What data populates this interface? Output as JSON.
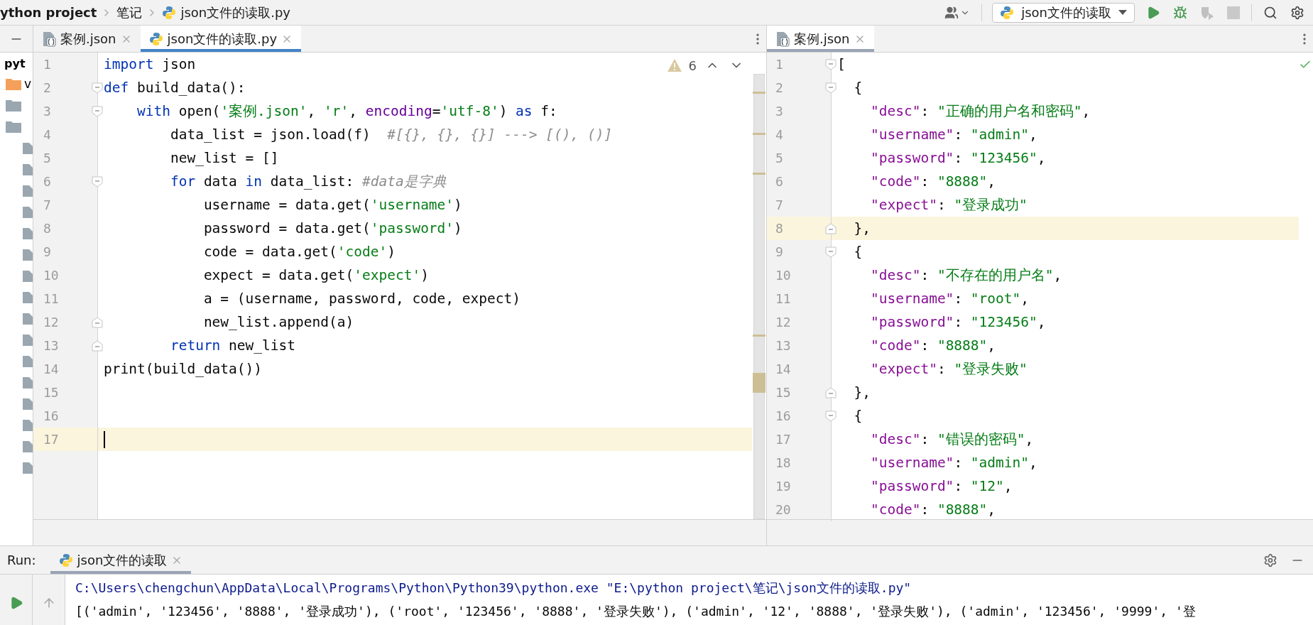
{
  "nav_bar": {
    "breadcrumbs": [
      {
        "label": "ython project",
        "kind": "project"
      },
      {
        "label": "笔记",
        "kind": "folder"
      },
      {
        "label": "json文件的读取.py",
        "kind": "python"
      }
    ],
    "run_config": "json文件的读取"
  },
  "project_tree": {
    "title": "pyt",
    "items": [
      {
        "label": "v",
        "kind": "venv"
      }
    ]
  },
  "editors": [
    {
      "focused": true,
      "inspections": {
        "kind": "warning",
        "count": "6"
      },
      "tabs": [
        {
          "label": "案例.json",
          "kind": "json",
          "selected": false
        },
        {
          "label": "json文件的读取.py",
          "kind": "python",
          "selected": true
        }
      ],
      "lines": [
        {
          "number": "1",
          "kind": "code",
          "current": false,
          "tokens": [
            {
              "kind": "keyword",
              "text": "import"
            },
            {
              "kind": "plain",
              "text": " json"
            }
          ]
        },
        {
          "number": "2",
          "kind": "fold-start",
          "current": false,
          "tokens": [
            {
              "kind": "keyword",
              "text": "def"
            },
            {
              "kind": "plain",
              "text": " build_data():"
            }
          ]
        },
        {
          "number": "3",
          "kind": "fold-start",
          "current": false,
          "tokens": [
            {
              "kind": "keyword",
              "text": "    with"
            },
            {
              "kind": "plain",
              "text": " open("
            },
            {
              "kind": "string",
              "text": "'案例.json'"
            },
            {
              "kind": "plain",
              "text": ", "
            },
            {
              "kind": "string",
              "text": "'r'"
            },
            {
              "kind": "plain",
              "text": ", "
            },
            {
              "kind": "param",
              "text": "encoding"
            },
            {
              "kind": "plain",
              "text": "="
            },
            {
              "kind": "string",
              "text": "'utf-8'"
            },
            {
              "kind": "plain",
              "text": ") "
            },
            {
              "kind": "keyword",
              "text": "as"
            },
            {
              "kind": "plain",
              "text": " f:"
            }
          ]
        },
        {
          "number": "4",
          "kind": "code",
          "current": false,
          "tokens": [
            {
              "kind": "plain",
              "text": "        data_list = json.load(f)  "
            },
            {
              "kind": "comment",
              "text": "#[{}, {}, {}] ---> [(), ()]"
            }
          ]
        },
        {
          "number": "5",
          "kind": "code",
          "current": false,
          "tokens": [
            {
              "kind": "plain",
              "text": "        new_list = []"
            }
          ]
        },
        {
          "number": "6",
          "kind": "fold-start",
          "current": false,
          "tokens": [
            {
              "kind": "keyword",
              "text": "        for"
            },
            {
              "kind": "plain",
              "text": " data "
            },
            {
              "kind": "keyword",
              "text": "in"
            },
            {
              "kind": "plain",
              "text": " data_list: "
            },
            {
              "kind": "comment",
              "text": "#data是字典"
            }
          ]
        },
        {
          "number": "7",
          "kind": "code",
          "current": false,
          "tokens": [
            {
              "kind": "plain",
              "text": "            username = data.get("
            },
            {
              "kind": "string",
              "text": "'username'"
            },
            {
              "kind": "plain",
              "text": ")"
            }
          ]
        },
        {
          "number": "8",
          "kind": "code",
          "current": false,
          "tokens": [
            {
              "kind": "plain",
              "text": "            password = data.get("
            },
            {
              "kind": "string",
              "text": "'password'"
            },
            {
              "kind": "plain",
              "text": ")"
            }
          ]
        },
        {
          "number": "9",
          "kind": "code",
          "current": false,
          "tokens": [
            {
              "kind": "plain",
              "text": "            code = data.get("
            },
            {
              "kind": "string",
              "text": "'code'"
            },
            {
              "kind": "plain",
              "text": ")"
            }
          ]
        },
        {
          "number": "10",
          "kind": "code",
          "current": false,
          "tokens": [
            {
              "kind": "plain",
              "text": "            expect = data.get("
            },
            {
              "kind": "string",
              "text": "'expect'"
            },
            {
              "kind": "plain",
              "text": ")"
            }
          ]
        },
        {
          "number": "11",
          "kind": "code",
          "current": false,
          "tokens": [
            {
              "kind": "plain",
              "text": "            a = (username, password, code, expect)"
            }
          ]
        },
        {
          "number": "12",
          "kind": "fold-end",
          "current": false,
          "tokens": [
            {
              "kind": "plain",
              "text": "            new_list.append(a)"
            }
          ]
        },
        {
          "number": "13",
          "kind": "fold-end",
          "current": false,
          "tokens": [
            {
              "kind": "keyword",
              "text": "        return"
            },
            {
              "kind": "plain",
              "text": " new_list"
            }
          ]
        },
        {
          "number": "14",
          "kind": "code",
          "current": false,
          "tokens": [
            {
              "kind": "plain",
              "text": "print(build_data())"
            }
          ]
        },
        {
          "number": "15",
          "kind": "code",
          "current": false
        },
        {
          "number": "16",
          "kind": "code",
          "current": false
        },
        {
          "number": "17",
          "kind": "code",
          "current": true
        }
      ]
    },
    {
      "focused": false,
      "inspections": {
        "kind": "ok"
      },
      "tabs": [
        {
          "label": "案例.json",
          "kind": "json",
          "selected": true
        }
      ],
      "lines": [
        {
          "number": "1",
          "kind": "fold-start",
          "current": false,
          "tokens": [
            {
              "kind": "plain",
              "text": "["
            }
          ]
        },
        {
          "number": "2",
          "kind": "fold-start",
          "current": false,
          "tokens": [
            {
              "kind": "plain",
              "text": "  {"
            }
          ]
        },
        {
          "number": "3",
          "kind": "code",
          "current": false,
          "tokens": [
            {
              "kind": "key",
              "text": "    \"desc\""
            },
            {
              "kind": "plain",
              "text": ": "
            },
            {
              "kind": "string",
              "text": "\"正确的用户名和密码\""
            },
            {
              "kind": "plain",
              "text": ","
            }
          ]
        },
        {
          "number": "4",
          "kind": "code",
          "current": false,
          "tokens": [
            {
              "kind": "key",
              "text": "    \"username\""
            },
            {
              "kind": "plain",
              "text": ": "
            },
            {
              "kind": "string",
              "text": "\"admin\""
            },
            {
              "kind": "plain",
              "text": ","
            }
          ]
        },
        {
          "number": "5",
          "kind": "code",
          "current": false,
          "tokens": [
            {
              "kind": "key",
              "text": "    \"password\""
            },
            {
              "kind": "plain",
              "text": ": "
            },
            {
              "kind": "string",
              "text": "\"123456\""
            },
            {
              "kind": "plain",
              "text": ","
            }
          ]
        },
        {
          "number": "6",
          "kind": "code",
          "current": false,
          "tokens": [
            {
              "kind": "key",
              "text": "    \"code\""
            },
            {
              "kind": "plain",
              "text": ": "
            },
            {
              "kind": "string",
              "text": "\"8888\""
            },
            {
              "kind": "plain",
              "text": ","
            }
          ]
        },
        {
          "number": "7",
          "kind": "code",
          "current": false,
          "tokens": [
            {
              "kind": "key",
              "text": "    \"expect\""
            },
            {
              "kind": "plain",
              "text": ": "
            },
            {
              "kind": "string",
              "text": "\"登录成功\""
            }
          ]
        },
        {
          "number": "8",
          "kind": "fold-end",
          "current": true,
          "tokens": [
            {
              "kind": "plain",
              "text": "  },"
            }
          ]
        },
        {
          "number": "9",
          "kind": "fold-start",
          "current": false,
          "tokens": [
            {
              "kind": "plain",
              "text": "  {"
            }
          ]
        },
        {
          "number": "10",
          "kind": "code",
          "current": false,
          "tokens": [
            {
              "kind": "key",
              "text": "    \"desc\""
            },
            {
              "kind": "plain",
              "text": ": "
            },
            {
              "kind": "string",
              "text": "\"不存在的用户名\""
            },
            {
              "kind": "plain",
              "text": ","
            }
          ]
        },
        {
          "number": "11",
          "kind": "code",
          "current": false,
          "tokens": [
            {
              "kind": "key",
              "text": "    \"username\""
            },
            {
              "kind": "plain",
              "text": ": "
            },
            {
              "kind": "string",
              "text": "\"root\""
            },
            {
              "kind": "plain",
              "text": ","
            }
          ]
        },
        {
          "number": "12",
          "kind": "code",
          "current": false,
          "tokens": [
            {
              "kind": "key",
              "text": "    \"password\""
            },
            {
              "kind": "plain",
              "text": ": "
            },
            {
              "kind": "string",
              "text": "\"123456\""
            },
            {
              "kind": "plain",
              "text": ","
            }
          ]
        },
        {
          "number": "13",
          "kind": "code",
          "current": false,
          "tokens": [
            {
              "kind": "key",
              "text": "    \"code\""
            },
            {
              "kind": "plain",
              "text": ": "
            },
            {
              "kind": "string",
              "text": "\"8888\""
            },
            {
              "kind": "plain",
              "text": ","
            }
          ]
        },
        {
          "number": "14",
          "kind": "code",
          "current": false,
          "tokens": [
            {
              "kind": "key",
              "text": "    \"expect\""
            },
            {
              "kind": "plain",
              "text": ": "
            },
            {
              "kind": "string",
              "text": "\"登录失败\""
            }
          ]
        },
        {
          "number": "15",
          "kind": "fold-end",
          "current": false,
          "tokens": [
            {
              "kind": "plain",
              "text": "  },"
            }
          ]
        },
        {
          "number": "16",
          "kind": "fold-start",
          "current": false,
          "tokens": [
            {
              "kind": "plain",
              "text": "  {"
            }
          ]
        },
        {
          "number": "17",
          "kind": "code",
          "current": false,
          "tokens": [
            {
              "kind": "key",
              "text": "    \"desc\""
            },
            {
              "kind": "plain",
              "text": ": "
            },
            {
              "kind": "string",
              "text": "\"错误的密码\""
            },
            {
              "kind": "plain",
              "text": ","
            }
          ]
        },
        {
          "number": "18",
          "kind": "code",
          "current": false,
          "tokens": [
            {
              "kind": "key",
              "text": "    \"username\""
            },
            {
              "kind": "plain",
              "text": ": "
            },
            {
              "kind": "string",
              "text": "\"admin\""
            },
            {
              "kind": "plain",
              "text": ","
            }
          ]
        },
        {
          "number": "19",
          "kind": "code",
          "current": false,
          "tokens": [
            {
              "kind": "key",
              "text": "    \"password\""
            },
            {
              "kind": "plain",
              "text": ": "
            },
            {
              "kind": "string",
              "text": "\"12\""
            },
            {
              "kind": "plain",
              "text": ","
            }
          ]
        },
        {
          "number": "20",
          "kind": "code",
          "current": false,
          "tokens": [
            {
              "kind": "key",
              "text": "    \"code\""
            },
            {
              "kind": "plain",
              "text": ": "
            },
            {
              "kind": "string",
              "text": "\"8888\""
            },
            {
              "kind": "plain",
              "text": ","
            }
          ]
        }
      ]
    }
  ],
  "run_panel": {
    "label": "Run:",
    "tabs": [
      {
        "label": "json文件的读取",
        "selected": true
      }
    ],
    "output": [
      {
        "kind": "command",
        "text": "C:\\Users\\chengchun\\AppData\\Local\\Programs\\Python\\Python39\\python.exe \"E:\\python project\\笔记\\json文件的读取.py\""
      },
      {
        "kind": "stdout",
        "text": "[('admin', '123456', '8888', '登录成功'), ('root', '123456', '8888', '登录失败'), ('admin', '12', '8888', '登录失败'), ('admin', '123456', '9999', '登"
      }
    ]
  }
}
